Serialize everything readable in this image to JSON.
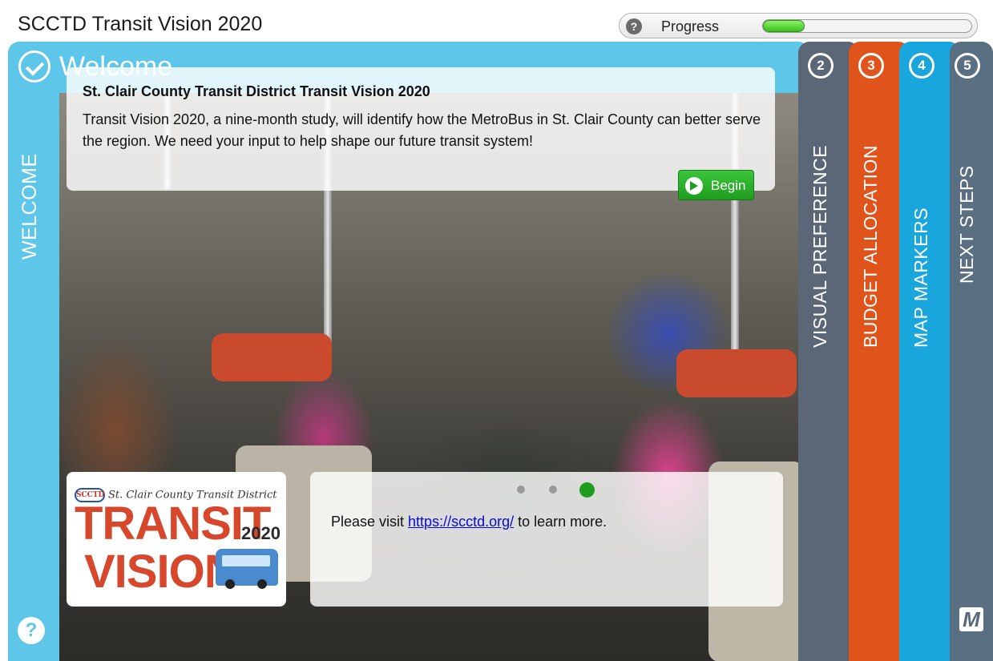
{
  "header": {
    "app_title": "SCCTD Transit Vision 2020",
    "progress_label": "Progress",
    "progress_help_icon": "help-circle-icon",
    "progress_value": 0.2
  },
  "welcome": {
    "title": "Welcome",
    "side_label": "WELCOME",
    "check_icon": "check-circle-icon",
    "help_icon": "help-circle-icon"
  },
  "intro": {
    "heading": "St. Clair County Transit District Transit Vision 2020",
    "body": "Transit Vision 2020, a nine-month study, will identify how the MetroBus in St. Clair County can better serve the region. We need your input to help shape our future transit system!",
    "begin_label": "Begin",
    "begin_icon": "arrow-right-circle-icon"
  },
  "logo": {
    "small_text": "St. Clair County Transit District",
    "badge_text": "SCCTD",
    "word_transit": "TRANSIT",
    "word_vision": "VISION",
    "year": "2020"
  },
  "info": {
    "text_before": "Please visit ",
    "link_text": "https://scctd.org/",
    "text_after": " to learn more.",
    "slides": 3,
    "active_slide": 3
  },
  "tabs": [
    {
      "number": "2",
      "label": "VISUAL PREFERENCE",
      "color": "#5b6677"
    },
    {
      "number": "3",
      "label": "BUDGET ALLOCATION",
      "color": "#e0541c"
    },
    {
      "number": "4",
      "label": "MAP MARKERS",
      "color": "#19a6dd"
    },
    {
      "number": "5",
      "label": "NEXT STEPS",
      "color": "#5b6f82"
    }
  ],
  "brand_logo_icon": "metroquest-logo-icon",
  "colors": {
    "welcome_panel": "#5ec6e8",
    "begin_green": "#1f9d1f",
    "dot_active": "#1f9d1f",
    "dot_inactive": "#9a9a9a"
  }
}
